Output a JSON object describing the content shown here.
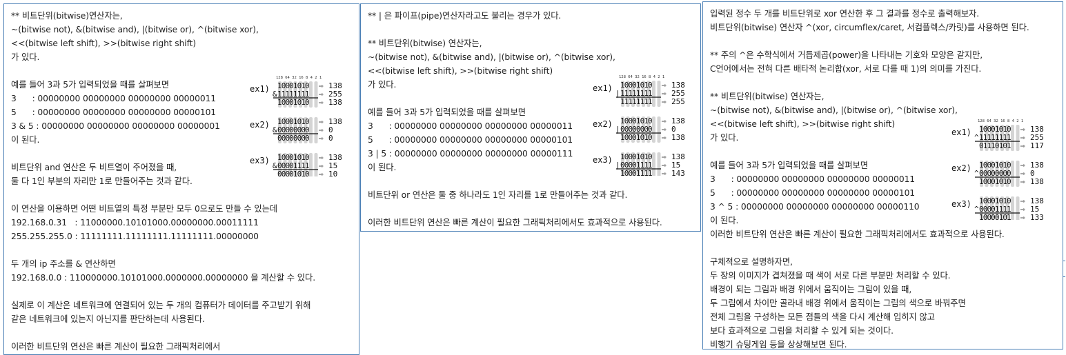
{
  "panels": [
    {
      "lines": [
        "** 비트단위(bitwise)연산자는,",
        "~(bitwise not), &(bitwise and), |(bitwise or), ^(bitwise xor),",
        "<<(bitwise left shift), >>(bitwise right shift)",
        "가 있다.",
        "",
        "예를 들어 3과 5가 입력되었을 때를 살펴보면",
        "3      : 00000000 00000000 00000000 00000011",
        "5      : 00000000 00000000 00000000 00000101",
        "3 & 5 : 00000000 00000000 00000000 00000001",
        "이 된다.",
        "",
        "비트단위 and 연산은 두 비트열이 주어졌을 때,",
        "둘 다 1인 부분의 자리만 1로 만들어주는 것과 같다.",
        "",
        "이 연산을 이용하면 어떤 비트열의 특정 부분만 모두 0으로도 만들 수 있는데",
        "192.168.0.31   : 11000000.10101000.00000000.00011111",
        "255.255.255.0 : 11111111.11111111.11111111.00000000",
        "",
        "두 개의 ip 주소를 & 연산하면",
        "192.168.0.0 : 110000000.10101000.0000000.00000000 을 계산할 수 있다.",
        "",
        "실제로 이 계산은 네트워크에 연결되어 있는 두 개의 컴퓨터가 데이터를 주고받기 위해",
        "같은 네트워크에 있는지 아닌지를 판단하는데 사용된다.",
        "",
        "이러한 비트단위 연산은 빠른 계산이 필요한 그래픽처리에서"
      ],
      "sketch": {
        "header": "128 64 32 16 8 4 2 1",
        "examples": [
          {
            "label": "ex1)",
            "a": "10001010",
            "b": "&11111111",
            "r": "10001010",
            "va": "138",
            "vb": "255",
            "vr": "138"
          },
          {
            "label": "ex2)",
            "a": "10001010",
            "b": "&00000000",
            "r": "00000000",
            "va": "138",
            "vb": "0",
            "vr": "0"
          },
          {
            "label": "ex3)",
            "a": "10001010",
            "b": "&00001111",
            "r": "00001010",
            "va": "138",
            "vb": "15",
            "vr": "10"
          }
        ]
      }
    },
    {
      "lines": [
        "** | 은 파이프(pipe)연산자라고도 불리는 경우가 있다.",
        "",
        "** 비트단위(bitwise) 연산자는,",
        "~(bitwise not), &(bitwise and), |(bitwise or), ^(bitwise xor),",
        "<<(bitwise left shift), >>(bitwise right shift)",
        "가 있다.",
        "",
        "예를 들어 3과 5가 입력되었을 때를 살펴보면",
        "3      : 00000000 00000000 00000000 00000011",
        "5      : 00000000 00000000 00000000 00000101",
        "3 | 5 : 00000000 00000000 00000000 00000111",
        "이 된다.",
        "",
        "비트단위 or 연산은 둘 중 하나라도 1인 자리를 1로 만들어주는 것과 같다.",
        "",
        "이러한 비트단위 연산은 빠른 계산이 필요한 그래픽처리에서도 효과적으로 사용된다."
      ],
      "sketch": {
        "header": "128 64 32 16 8 4 2 1",
        "examples": [
          {
            "label": "ex1)",
            "a": "10001010",
            "b": "|11111111",
            "r": "11111111",
            "va": "138",
            "vb": "255",
            "vr": "255"
          },
          {
            "label": "ex2)",
            "a": "10001010",
            "b": "|00000000",
            "r": "10001010",
            "va": "138",
            "vb": "0",
            "vr": "138"
          },
          {
            "label": "ex3)",
            "a": "10001010",
            "b": "|00001111",
            "r": "10001111",
            "va": "138",
            "vb": "15",
            "vr": "143"
          }
        ]
      }
    },
    {
      "lines": [
        "입력된 정수 두 개를 비트단위로 xor 연산한 후 그 결과를 정수로 출력해보자.",
        "비트단위(bitwise) 연산자 ^(xor, circumflex/caret, 서컴플렉스/카릿)를 사용하면 된다.",
        "",
        "** 주의 ^은 수학식에서 거듭제곱(power)을 나타내는 기호와 모양은 같지만,",
        "C언어에서는 전혀 다른 배타적 논리합(xor, 서로 다를 때 1)의 의미를 가진다.",
        "",
        "** 비트단위(bitwise) 연산자는,",
        "~(bitwise not), &(bitwise and), |(bitwise or), ^(bitwise xor),",
        "<<(bitwise left shift), >>(bitwise right shift)",
        "가 있다.",
        "",
        "예를 들어 3과 5가 입력되었을 때를 살펴보면",
        "3      : 00000000 00000000 00000000 00000011",
        "5      : 00000000 00000000 00000000 00000101",
        "3 ^ 5 : 00000000 00000000 00000000 00000110",
        "이 된다.",
        "이러한 비트단위 연산은 빠른 계산이 필요한 그래픽처리에서도 효과적으로 사용된다.",
        "",
        "구체적으로 설명하자면,",
        "두 장의 이미지가 겹쳐졌을 때 색이 서로 다른 부분만 처리할 수 있다.",
        "배경이 되는 그림과 배경 위에서 움직이는 그림이 있을 때,",
        "두 그림에서 차이만 골라내 배경 위에서 움직이는 그림의 색으로 바꿔주면",
        "전체 그림을 구성하는 모든 점들의 색을 다시 계산해 입히지 않고",
        "보다 효과적으로 그림을 처리할 수 있게 되는 것이다.",
        "비행기 슈팅게임 등을 상상해보면 된다."
      ],
      "sketch": {
        "header": "128 64 32 16 8 4 2 1",
        "examples": [
          {
            "label": "ex1)",
            "a": "10001010",
            "b": "^11111111",
            "r": "01110101",
            "va": "138",
            "vb": "255",
            "vr": "117"
          },
          {
            "label": "ex2)",
            "a": "10001010",
            "b": "^00000000",
            "r": "10001010",
            "va": "138",
            "vb": "0",
            "vr": "138"
          },
          {
            "label": "ex3)",
            "a": "10001010",
            "b": "^00001111",
            "r": "10000101",
            "va": "138",
            "vb": "15",
            "vr": "133"
          }
        ]
      }
    }
  ]
}
